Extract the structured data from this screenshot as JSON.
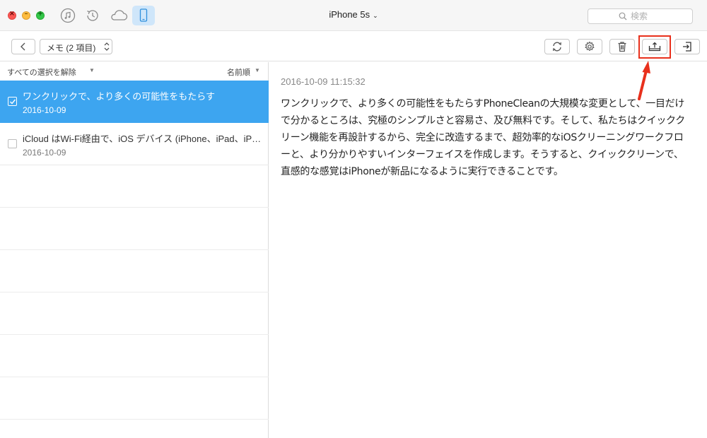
{
  "window": {
    "device_title": "iPhone 5s",
    "search_placeholder": "検索"
  },
  "top_icons": [
    "music-icon",
    "history-icon",
    "cloud-icon",
    "phone-icon"
  ],
  "toolbar": {
    "category_label": "メモ (2 項目)"
  },
  "list": {
    "deselect_all": "すべての選択を解除",
    "sort_label": "名前順",
    "notes": [
      {
        "title": "ワンクリックで、より多くの可能性をもたらす",
        "date": "2016-10-09",
        "selected": true
      },
      {
        "title": "iCloud はWi-Fi経由で、iOS デバイス (iPhone、iPad、iPo…",
        "date": "2016-10-09",
        "selected": false
      }
    ]
  },
  "detail": {
    "timestamp": "2016-10-09 11:15:32",
    "body": "ワンクリックで、より多くの可能性をもたらすPhoneCleanの大規模な変更として、一目だけで分かるところは、究極のシンプルさと容易さ、及び無料です。そして、私たちはクイッククリーン機能を再設計するから、完全に改造するまで、超効率的なiOSクリーニングワークフローと、より分かりやすいインターフェイスを作成します。そうすると、クイッククリーンで、直感的な感覚はiPhoneが新品になるように実行できることです。"
  },
  "colors": {
    "selected_row": "#3da5f0",
    "highlight_box": "#e8301c",
    "device_button": "#cfe6fa"
  }
}
